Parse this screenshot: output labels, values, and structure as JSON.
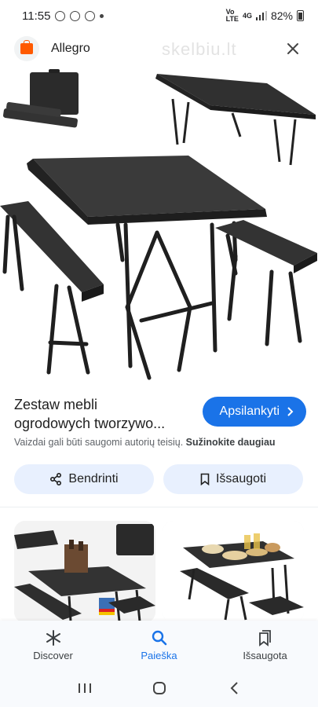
{
  "status": {
    "time": "11:55",
    "battery": "82%",
    "network": "4G"
  },
  "header": {
    "site_name": "Allegro",
    "watermark": "skelbiu.lt"
  },
  "product": {
    "title_line1": "Zestaw mebli",
    "title_line2": "ogrodowych tworzywo...",
    "visit_label": "Apsilankyti",
    "copyright_text": "Vaizdai gali būti saugomi autorių teisių.",
    "learn_more": "Sužinokite daugiau"
  },
  "actions": {
    "share_label": "Bendrinti",
    "save_label": "Išsaugoti"
  },
  "bottom_nav": {
    "items": [
      {
        "label": "Discover",
        "icon": "asterisk-icon"
      },
      {
        "label": "Paieška",
        "icon": "search-icon"
      },
      {
        "label": "Išsaugota",
        "icon": "saved-icon"
      }
    ]
  },
  "colors": {
    "accent": "#1a73e8",
    "chip_bg": "#e8f0fe",
    "brand": "#ff5a00"
  }
}
